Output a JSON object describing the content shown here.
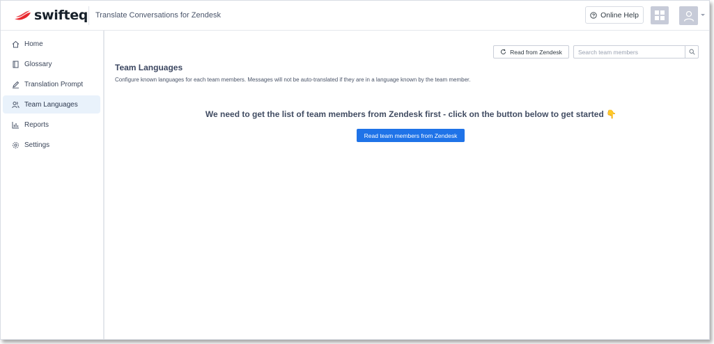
{
  "brand": {
    "name": "swifteq",
    "accent": "#e8262d"
  },
  "header": {
    "app_title": "Translate Conversations for Zendesk",
    "help_label": "Online Help"
  },
  "sidebar": {
    "items": [
      {
        "label": "Home",
        "icon": "home-icon",
        "active": false
      },
      {
        "label": "Glossary",
        "icon": "book-icon",
        "active": false
      },
      {
        "label": "Translation Prompt",
        "icon": "pencil-icon",
        "active": false
      },
      {
        "label": "Team Languages",
        "icon": "team-icon",
        "active": true
      },
      {
        "label": "Reports",
        "icon": "bar-chart-icon",
        "active": false
      },
      {
        "label": "Settings",
        "icon": "gear-icon",
        "active": false
      }
    ]
  },
  "main": {
    "read_button_label": "Read from Zendesk",
    "search_placeholder": "Search team members",
    "title": "Team Languages",
    "description": "Configure known languages for each team members. Messages will not be auto-translated if they are in a language known by the team member.",
    "empty_message": "We need to get the list of team members from Zendesk first - click on the button below to get started 👇",
    "primary_button_label": "Read team members from Zendesk"
  },
  "colors": {
    "primary": "#1f73e8",
    "active_nav_bg": "#e9f2fb",
    "avatar_bg": "#c7cbd8"
  }
}
